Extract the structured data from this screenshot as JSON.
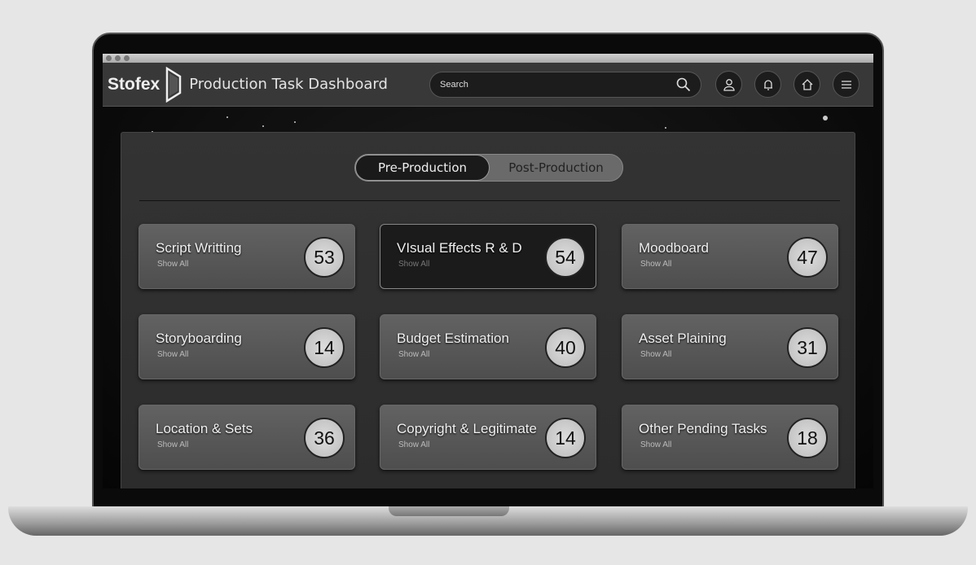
{
  "header": {
    "brand": "Stofex",
    "title": "Production Task Dashboard",
    "search_placeholder": "Search"
  },
  "tabs": [
    {
      "label": "Pre-Production",
      "active": true
    },
    {
      "label": "Post-Production",
      "active": false
    }
  ],
  "cards": [
    {
      "title": "Script Writting",
      "link": "Show All",
      "count": "53"
    },
    {
      "title": "VIsual Effects R & D",
      "link": "Show All",
      "count": "54",
      "active": true
    },
    {
      "title": "Moodboard",
      "link": "Show All",
      "count": "47"
    },
    {
      "title": "Storyboarding",
      "link": "Show All",
      "count": "14"
    },
    {
      "title": "Budget Estimation",
      "link": "Show All",
      "count": "40"
    },
    {
      "title": "Asset Plaining",
      "link": "Show All",
      "count": "31"
    },
    {
      "title": "Location & Sets",
      "link": "Show All",
      "count": "36"
    },
    {
      "title": "Copyright & Legitimate",
      "link": "Show All",
      "count": "14"
    },
    {
      "title": "Other Pending Tasks",
      "link": "Show All",
      "count": "18"
    }
  ]
}
